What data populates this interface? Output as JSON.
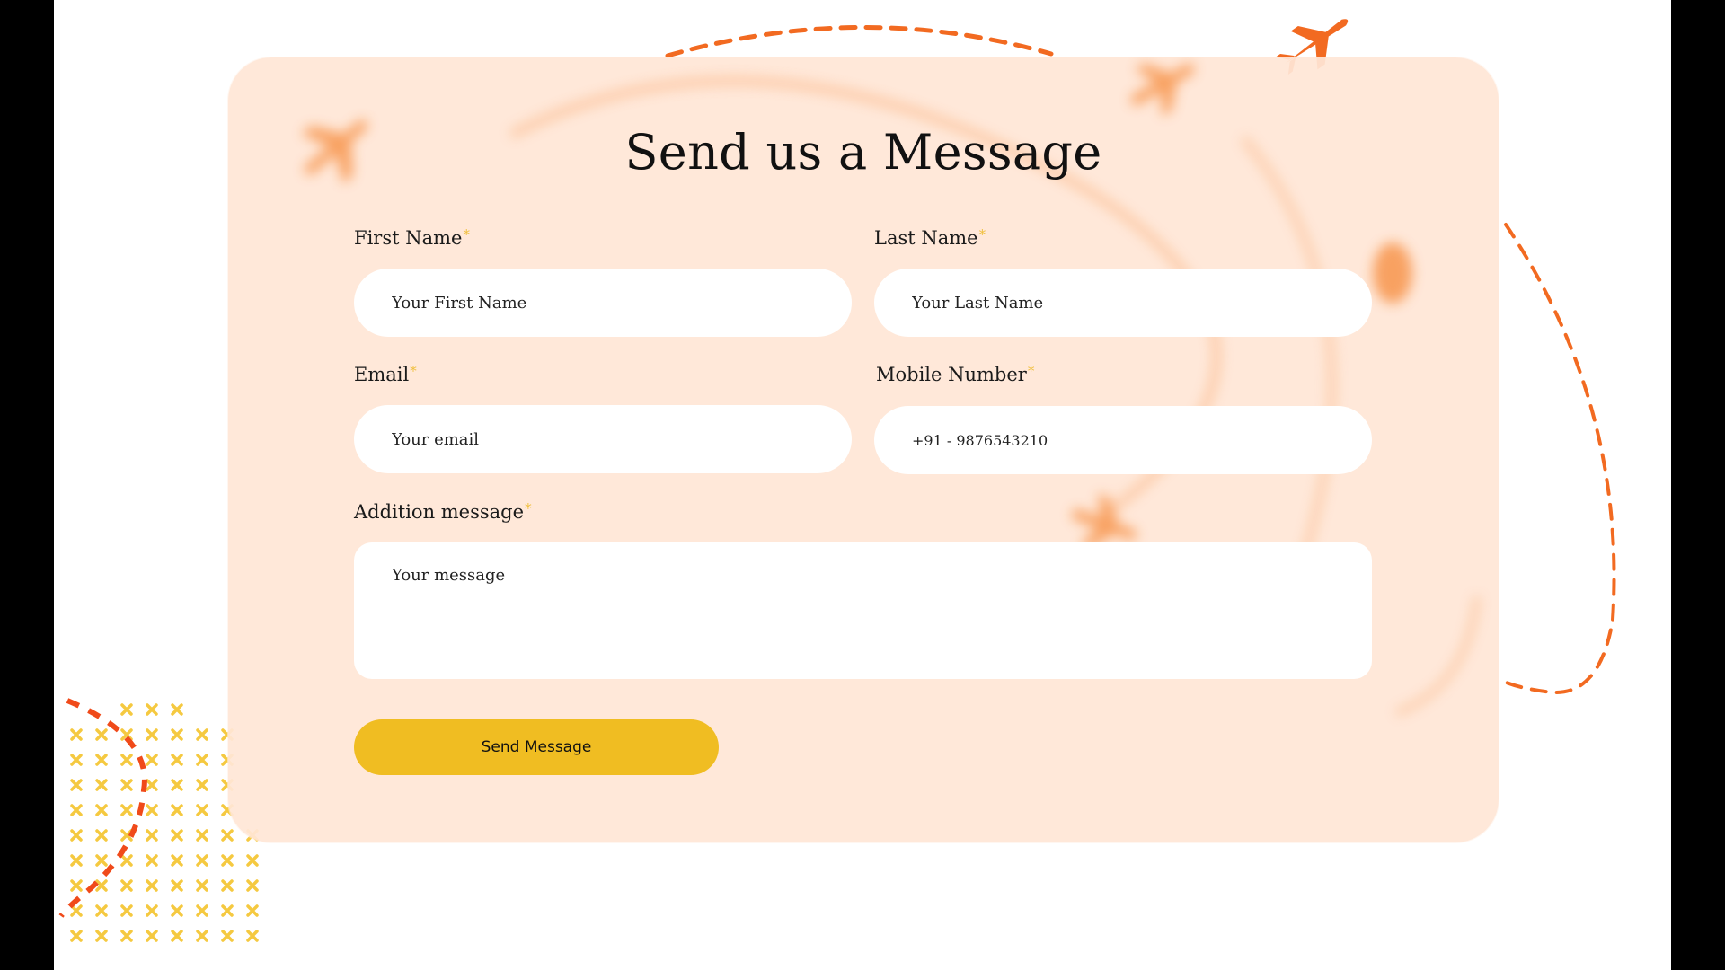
{
  "form": {
    "title": "Send us a Message",
    "required_mark": "*",
    "first_name": {
      "label": "First Name",
      "placeholder": "Your First Name",
      "value": ""
    },
    "last_name": {
      "label": "Last Name",
      "placeholder": "Your Last Name",
      "value": ""
    },
    "email": {
      "label": "Email",
      "placeholder": "Your email",
      "value": ""
    },
    "mobile": {
      "label": "Mobile Number",
      "placeholder": "+91 - 9876543210",
      "value": ""
    },
    "message": {
      "label": "Addition message",
      "placeholder": "Your message",
      "value": ""
    },
    "submit_label": "Send Message"
  },
  "decor": {
    "accent_orange": "#f26a21",
    "accent_yellow": "#f0bd22",
    "card_background": "#ffe6d6",
    "icons": [
      "airplane-icon",
      "location-pin-icon",
      "cross-pattern"
    ]
  }
}
